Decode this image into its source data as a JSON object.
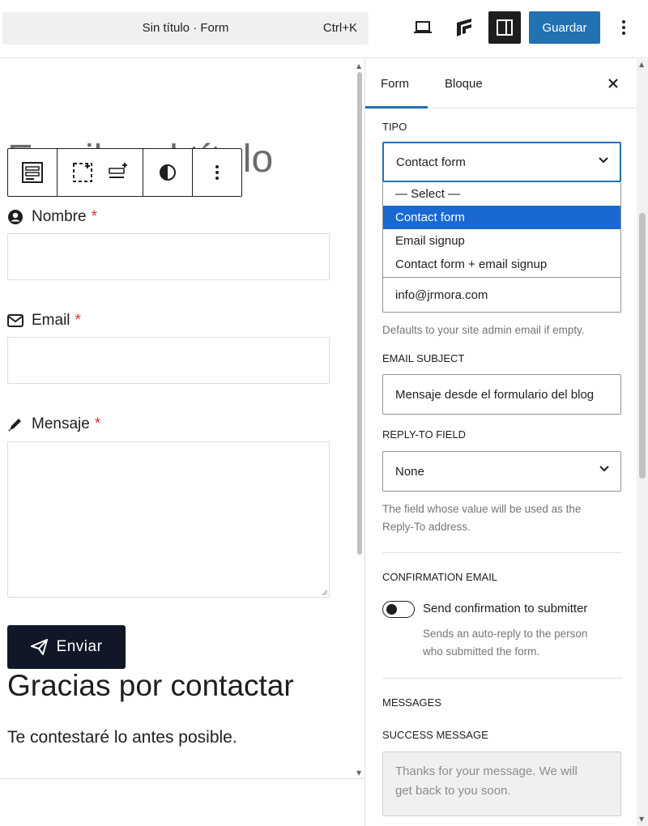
{
  "topbar": {
    "command_title": "Sin título · Form",
    "command_shortcut": "Ctrl+K",
    "save_label": "Guardar",
    "icons": [
      "laptop-icon",
      "jetpack-icon",
      "sidebar-toggle-icon",
      "more-vertical-icon"
    ]
  },
  "canvas": {
    "page_title": "Escribe el título",
    "block_toolbar_icons": [
      "form-block-icon",
      "add-field-icon",
      "insert-after-icon",
      "contrast-icon",
      "more-vertical-icon"
    ],
    "fields": [
      {
        "label": "Nombre",
        "required_mark": "*",
        "icon": "user-circle-icon"
      },
      {
        "label": "Email",
        "required_mark": "*",
        "icon": "envelope-icon"
      },
      {
        "label": "Mensaje",
        "required_mark": "*",
        "icon": "pencil-icon"
      }
    ],
    "submit_label": "Enviar",
    "thanks_title": "Gracias por contactar",
    "thanks_text": "Te contestaré lo antes posible."
  },
  "sidebar": {
    "tabs": [
      {
        "label": "Form",
        "active": true
      },
      {
        "label": "Bloque",
        "active": false
      }
    ],
    "type_section_label": "TIPO",
    "type_selected": "Contact form",
    "type_options": [
      "— Select —",
      "Contact form",
      "Email signup",
      "Contact form + email signup"
    ],
    "email_to_value": "info@jrmora.com",
    "email_to_help": "Defaults to your site admin email if empty.",
    "email_subject_label": "EMAIL SUBJECT",
    "email_subject_value": "Mensaje desde el formulario del blog",
    "reply_to_label": "REPLY-TO FIELD",
    "reply_to_value": "None",
    "reply_to_help_1": "The field whose value will be used as the",
    "reply_to_help_2": "Reply-To address.",
    "confirmation_label": "CONFIRMATION EMAIL",
    "confirmation_toggle_label": "Send confirmation to submitter",
    "confirmation_toggle_on": false,
    "confirmation_help_1": "Sends an auto-reply to the person",
    "confirmation_help_2": "who submitted the form.",
    "messages_label": "MESSAGES",
    "success_label": "SUCCESS MESSAGE",
    "success_placeholder_1": "Thanks for your message. We will",
    "success_placeholder_2": "get back to you soon."
  },
  "colors": {
    "accent": "#2271b1",
    "selected_option": "#1a69d3",
    "required": "#d63638",
    "submit_bg": "#101828"
  }
}
